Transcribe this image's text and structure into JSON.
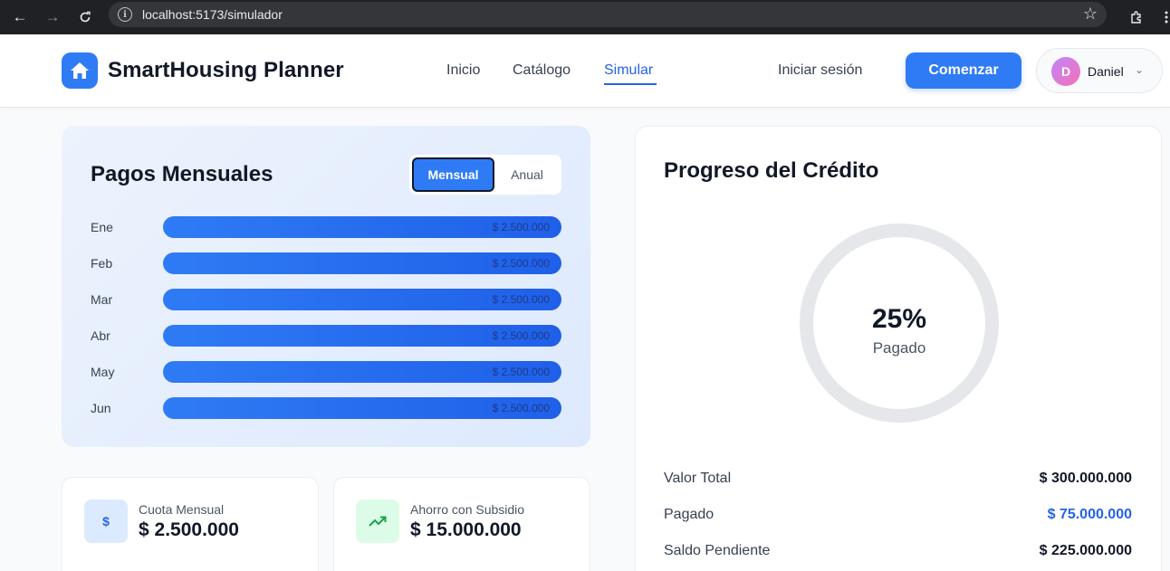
{
  "browser": {
    "url": "localhost:5173/simulador"
  },
  "header": {
    "brand": "SmartHousing Planner",
    "nav": [
      "Inicio",
      "Catálogo",
      "Simular"
    ],
    "login": "Iniciar sesión",
    "start": "Comenzar",
    "user": {
      "initial": "D",
      "name": "Daniel"
    }
  },
  "payments": {
    "title": "Pagos Mensuales",
    "toggle": {
      "monthly": "Mensual",
      "annual": "Anual"
    },
    "rows": [
      {
        "month": "Ene",
        "amount": "$ 2.500.000"
      },
      {
        "month": "Feb",
        "amount": "$ 2.500.000"
      },
      {
        "month": "Mar",
        "amount": "$ 2.500.000"
      },
      {
        "month": "Abr",
        "amount": "$ 2.500.000"
      },
      {
        "month": "May",
        "amount": "$ 2.500.000"
      },
      {
        "month": "Jun",
        "amount": "$ 2.500.000"
      }
    ]
  },
  "stats": {
    "cuota": {
      "label": "Cuota Mensual",
      "value": "$ 2.500.000",
      "icon": "dollar-icon"
    },
    "ahorro": {
      "label": "Ahorro con Subsidio",
      "value": "$ 15.000.000",
      "icon": "trending-up-icon"
    }
  },
  "progress": {
    "title": "Progreso del Crédito",
    "percent": "25%",
    "percent_label": "Pagado",
    "rows": [
      {
        "label": "Valor Total",
        "value": "$ 300.000.000"
      },
      {
        "label": "Pagado",
        "value": "$ 75.000.000"
      },
      {
        "label": "Saldo Pendiente",
        "value": "$ 225.000.000"
      }
    ]
  },
  "colors": {
    "accent": "#2f7bf5",
    "paid_value": "#2563eb",
    "savings_icon": "#16a34a"
  }
}
